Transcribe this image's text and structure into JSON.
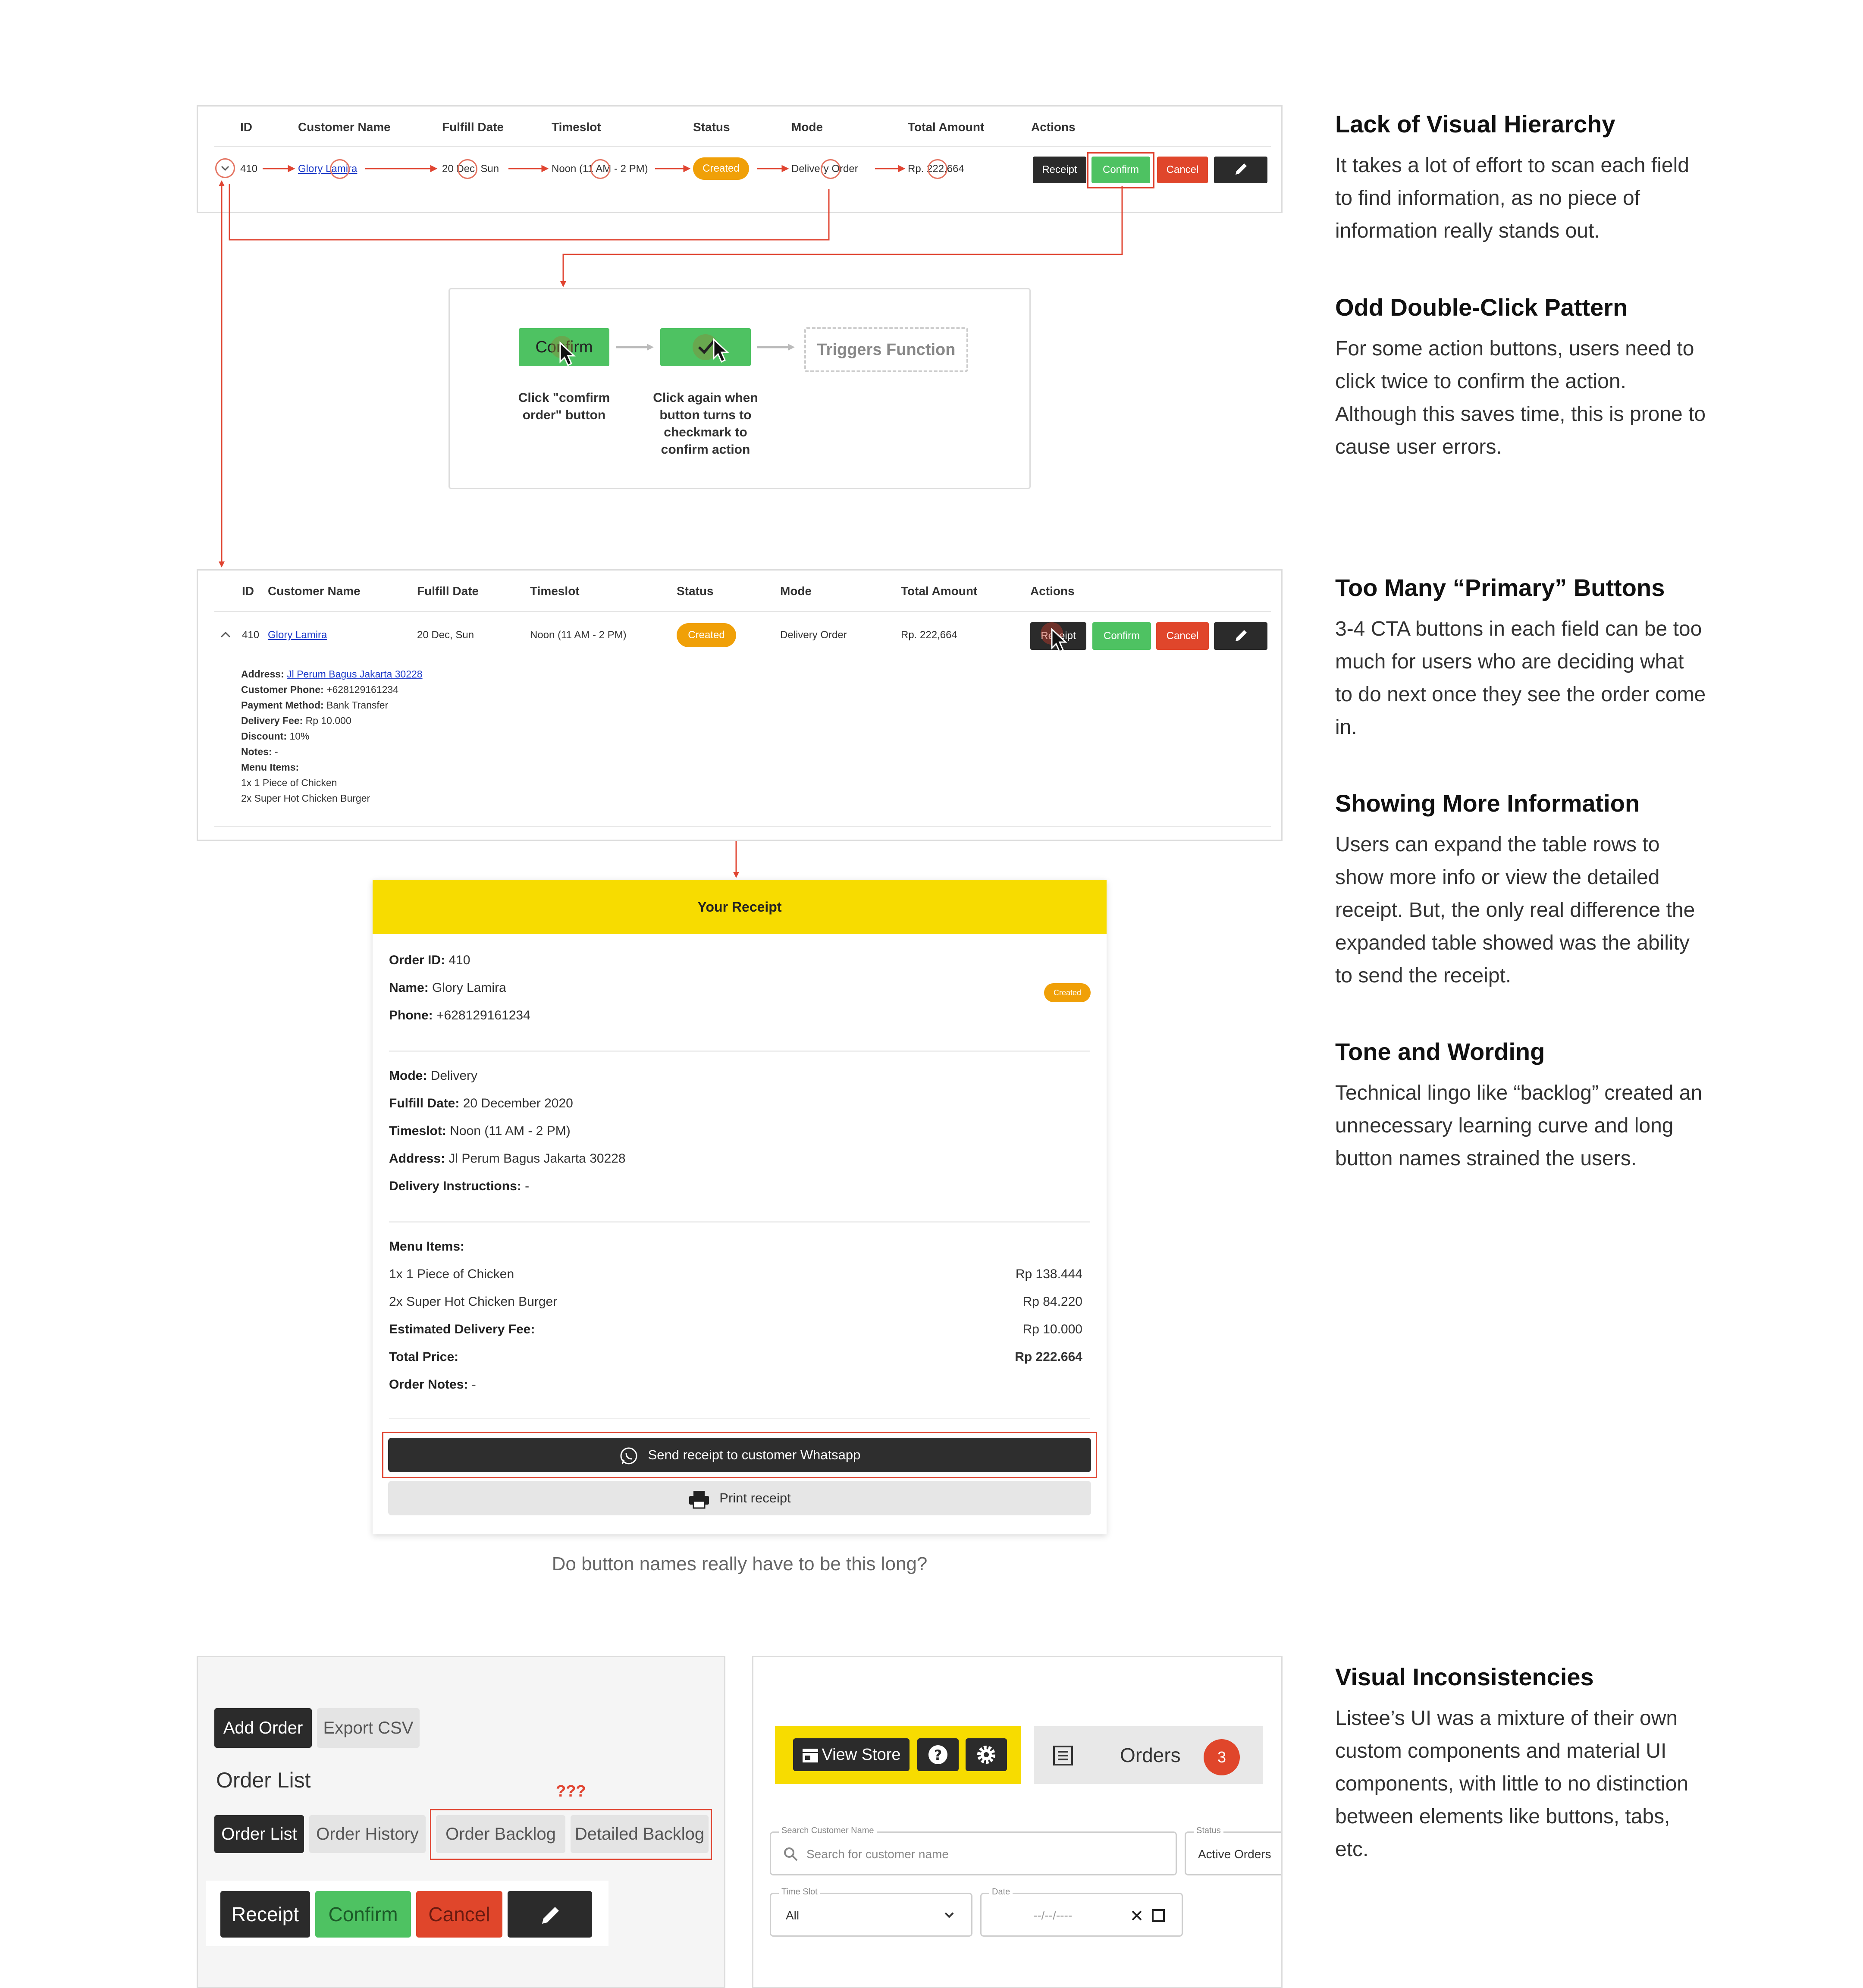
{
  "table1": {
    "headers": [
      "ID",
      "Customer Name",
      "Fulfill Date",
      "Timeslot",
      "Status",
      "Mode",
      "Total Amount",
      "Actions"
    ],
    "row": {
      "id": "410",
      "customer": "Glory Lamira",
      "date": "20 Dec, Sun",
      "timeslot": "Noon (11 AM - 2 PM)",
      "status": "Created",
      "mode": "Delivery Order",
      "total": "Rp. 222,664"
    },
    "actions": {
      "receipt": "Receipt",
      "confirm": "Confirm",
      "cancel": "Cancel"
    }
  },
  "flow": {
    "confirm_label": "Confirm",
    "step1": "Click \"comfirm order\" button",
    "step2": "Click again when button turns to checkmark to confirm action",
    "triggers": "Triggers Function"
  },
  "table2": {
    "headers": [
      "ID",
      "Customer Name",
      "Fulfill Date",
      "Timeslot",
      "Status",
      "Mode",
      "Total Amount",
      "Actions"
    ],
    "row": {
      "id": "410",
      "customer": "Glory Lamira",
      "date": "20 Dec, Sun",
      "timeslot": "Noon (11 AM - 2 PM)",
      "status": "Created",
      "mode": "Delivery Order",
      "total": "Rp. 222,664"
    },
    "actions": {
      "receipt": "Receipt",
      "confirm": "Confirm",
      "cancel": "Cancel"
    },
    "details": {
      "address_label": "Address:",
      "address": "Jl Perum Bagus Jakarta 30228",
      "phone_label": "Customer Phone:",
      "phone": "+628129161234",
      "payment_label": "Payment Method:",
      "payment": "Bank Transfer",
      "fee_label": "Delivery Fee:",
      "fee": "Rp 10.000",
      "discount_label": "Discount:",
      "discount": "10%",
      "notes_label": "Notes:",
      "notes": "-",
      "menu_label": "Menu Items:",
      "items": [
        "1x 1 Piece of Chicken",
        "2x Super Hot Chicken Burger"
      ]
    }
  },
  "receipt": {
    "title": "Your Receipt",
    "order_id_label": "Order ID:",
    "order_id": "410",
    "name_label": "Name:",
    "name": "Glory Lamira",
    "phone_label": "Phone:",
    "phone": "+628129161234",
    "status": "Created",
    "mode_label": "Mode:",
    "mode": "Delivery",
    "fulfill_label": "Fulfill Date:",
    "fulfill": "20 December 2020",
    "timeslot_label": "Timeslot:",
    "timeslot": "Noon (11 AM - 2 PM)",
    "address_label": "Address:",
    "address": "Jl Perum Bagus Jakarta 30228",
    "instructions_label": "Delivery Instructions:",
    "instructions": "-",
    "menu_label": "Menu Items:",
    "items": [
      {
        "name": "1x 1 Piece of Chicken",
        "price": "Rp 138.444"
      },
      {
        "name": "2x Super Hot Chicken Burger",
        "price": "Rp 84.220"
      }
    ],
    "fee_label": "Estimated Delivery Fee:",
    "fee": "Rp 10.000",
    "total_label": "Total Price:",
    "total": "Rp 222.664",
    "notes_label": "Order Notes:",
    "notes": "-",
    "whatsapp_button": "Send receipt to customer Whatsapp",
    "print_button": "Print receipt"
  },
  "caption": "Do button names really have to be this long?",
  "notes": [
    {
      "title": "Lack of Visual Hierarchy",
      "body": "It takes a lot of effort to scan each field to find information, as no piece of information really stands out."
    },
    {
      "title": "Odd Double-Click Pattern",
      "body": "For some action buttons, users need to click twice to confirm the action. Although this saves time, this is prone to cause user errors."
    },
    {
      "title": "Too Many “Primary” Buttons",
      "body": "3-4 CTA buttons in each field can be too much for users who are deciding what to do next once they see the order come in."
    },
    {
      "title": "Showing More Information",
      "body": "Users can expand the table rows to show more info or view the detailed receipt. But, the only real difference the expanded table showed was the ability to send the receipt."
    },
    {
      "title": "Tone and Wording",
      "body": "Technical lingo like “backlog” created an unnecessary learning curve and long button names strained the users."
    },
    {
      "title": "Visual Inconsistencies",
      "body": "Listee’s UI was a mixture of their own custom components and material UI components, with little to no distinction between elements like buttons, tabs, etc."
    }
  ],
  "mix_left": {
    "add_order": "Add Order",
    "export_csv": "Export CSV",
    "title": "Order List",
    "question": "???",
    "tabs": [
      "Order List",
      "Order History",
      "Order Backlog",
      "Detailed Backlog"
    ],
    "actions": {
      "receipt": "Receipt",
      "confirm": "Confirm",
      "cancel": "Cancel"
    }
  },
  "mix_right": {
    "view_store": "View Store",
    "orders": "Orders",
    "orders_count": "3",
    "search_label": "Search Customer Name",
    "search_placeholder": "Search for customer name",
    "status_label": "Status",
    "status_value": "Active Orders",
    "timeslot_label": "Time Slot",
    "timeslot_value": "All",
    "date_label": "Date",
    "date_placeholder": "--/--/----"
  },
  "colors": {
    "accent_red": "#e04431",
    "green": "#4ec262",
    "dark": "#2b2b2b",
    "orange": "#f0a008",
    "yellow": "#f7dc00"
  }
}
